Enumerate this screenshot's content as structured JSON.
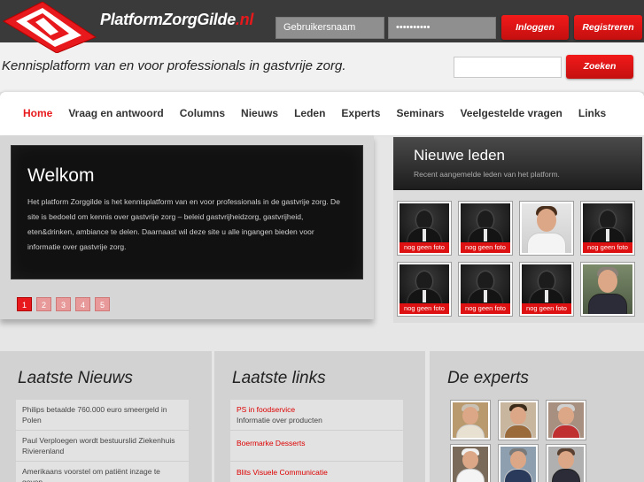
{
  "header": {
    "logo_text": "PlatformZorgGilde",
    "logo_tld": ".nl",
    "username_value": "Gebruikersnaam",
    "password_value": "••••••••••",
    "login_label": "Inloggen",
    "register_label": "Registreren",
    "tagline": "Kennisplatform van en voor professionals in gastvrije zorg.",
    "search_label": "Zoeken"
  },
  "nav": {
    "items": [
      {
        "label": "Home",
        "active": true
      },
      {
        "label": "Vraag en antwoord"
      },
      {
        "label": "Columns"
      },
      {
        "label": "Nieuws"
      },
      {
        "label": "Leden"
      },
      {
        "label": "Experts"
      },
      {
        "label": "Seminars"
      },
      {
        "label": "Veelgestelde vragen"
      },
      {
        "label": "Links"
      }
    ]
  },
  "slider": {
    "title": "Welkom",
    "text": "Het platform Zorggilde is het kennisplatform van en voor professionals in de gastvrije zorg. De site is bedoeld om kennis over gastvrije zorg – beleid gastvrijheidzorg, gastvrijheid, eten&drinken, ambiance te delen. Daarnaast wil deze site u alle ingangen bieden voor informatie over gastvrije zorg.",
    "pages": [
      "1",
      "2",
      "3",
      "4",
      "5"
    ],
    "active_page": 0
  },
  "members": {
    "title": "Nieuwe leden",
    "subtitle": "Recent aangemelde leden van het platform.",
    "no_photo_label": "nog geen foto"
  },
  "news": {
    "title": "Laatste Nieuws",
    "items": [
      "Philips betaalde 760.000 euro smeergeld in Polen",
      "Paul Verploegen wordt bestuurslid Ziekenhuis Rivierenland",
      "Amerikaans voorstel om patiënt inzage te geven"
    ]
  },
  "links": {
    "title": "Laatste links",
    "items": [
      {
        "title": "PS in foodservice",
        "desc": "Informatie over producten"
      },
      {
        "title": "Boermarke Desserts",
        "desc": ""
      },
      {
        "title": "Blits Visuele Communicatie",
        "desc": ""
      }
    ]
  },
  "experts": {
    "title": "De experts"
  },
  "colors": {
    "accent_red": "#e8191c",
    "header_dark": "#3a3a3a"
  }
}
